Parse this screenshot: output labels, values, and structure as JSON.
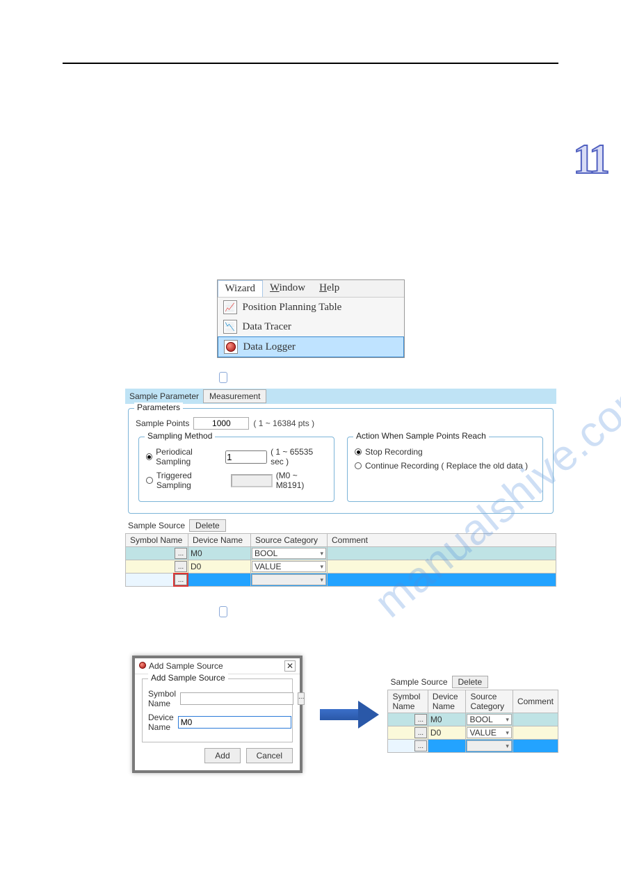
{
  "chapter_number": "11",
  "watermark": "manualshive.com",
  "menu": {
    "wizard": "Wizard",
    "window": "Window",
    "help": "Help",
    "items": {
      "ppt": "Position Planning Table",
      "tracer": "Data Tracer",
      "logger": "Data Logger"
    }
  },
  "tabs": {
    "sample_parameter": "Sample Parameter",
    "measurement": "Measurement"
  },
  "params": {
    "group": "Parameters",
    "sample_points_label": "Sample Points",
    "sample_points_value": "1000",
    "sample_points_hint": "( 1 ~ 16384 pts )",
    "sampling_method_group": "Sampling Method",
    "periodical": "Periodical Sampling",
    "periodical_value": "1",
    "periodical_hint": "( 1 ~ 65535 sec )",
    "triggered": "Triggered Sampling",
    "triggered_hint": "(M0 ~ M8191)",
    "action_group": "Action When Sample Points Reach",
    "stop": "Stop Recording",
    "continue": "Continue Recording ( Replace the old data )"
  },
  "source": {
    "label": "Sample Source",
    "delete": "Delete",
    "cols": {
      "symbol": "Symbol Name",
      "device": "Device Name",
      "category": "Source Category",
      "comment": "Comment"
    },
    "r1_dev": "M0",
    "r1_cat": "BOOL",
    "r2_dev": "D0",
    "r2_cat": "VALUE",
    "dots": "..."
  },
  "dialog": {
    "title": "Add Sample Source",
    "group": "Add Sample Source",
    "symbol_label": "Symbol Name",
    "device_label": "Device Name",
    "device_value": "M0",
    "add": "Add",
    "cancel": "Cancel",
    "close": "✕"
  }
}
